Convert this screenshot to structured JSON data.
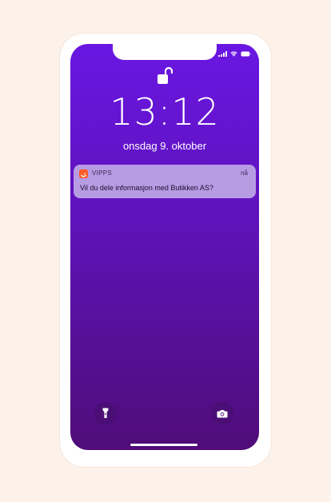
{
  "lockscreen": {
    "time": "13:12",
    "date": "onsdag 9. oktober"
  },
  "notification": {
    "app_name": "VIPPS",
    "timestamp": "nå",
    "message": "Vil du dele informasjon med Butikken AS?",
    "app_icon_color": "#ff5b24"
  },
  "icons": {
    "status": [
      "signal-icon",
      "wifi-icon",
      "battery-icon"
    ],
    "lock": "unlocked-padlock-icon",
    "flashlight": "flashlight-icon",
    "camera": "camera-icon"
  },
  "colors": {
    "background": "#fdf2e9",
    "screen_gradient_top": "#6a16e3",
    "screen_gradient_bottom": "#500c78",
    "notification_bg": "#b79be3"
  }
}
